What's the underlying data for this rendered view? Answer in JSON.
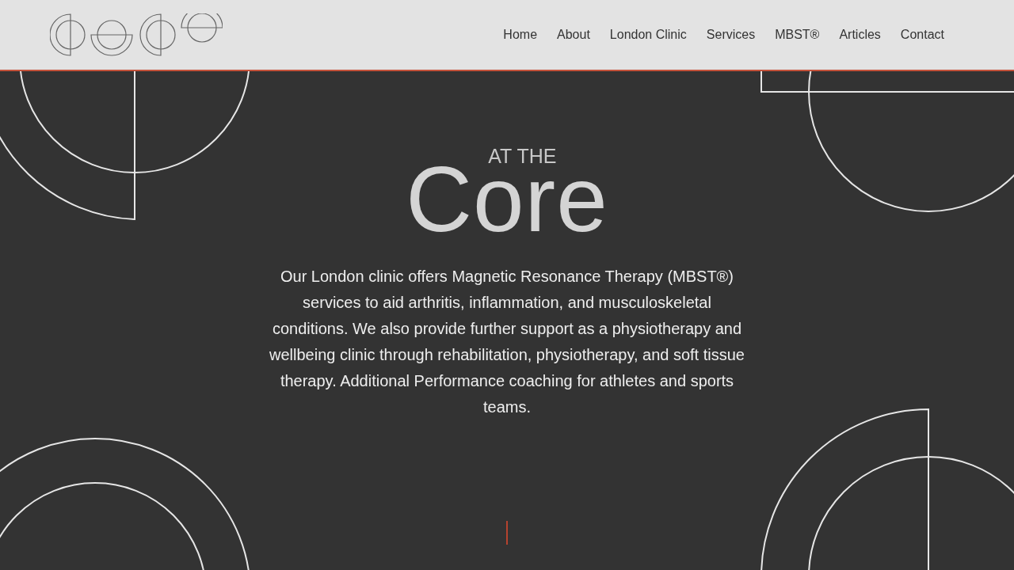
{
  "nav": [
    {
      "label": "Home"
    },
    {
      "label": "About"
    },
    {
      "label": "London Clinic"
    },
    {
      "label": "Services"
    },
    {
      "label": "MBST®"
    },
    {
      "label": "Articles"
    },
    {
      "label": "Contact"
    }
  ],
  "hero": {
    "kicker": "AT THE",
    "title": "Core",
    "body": "Our London clinic offers Magnetic Resonance Therapy (MBST®) services to aid arthritis, inflammation, and musculoskeletal conditions. We also provide further support as a physiotherapy and wellbeing clinic through rehabilitation, physiotherapy, and soft tissue therapy. Additional Performance coaching for athletes and sports teams."
  }
}
